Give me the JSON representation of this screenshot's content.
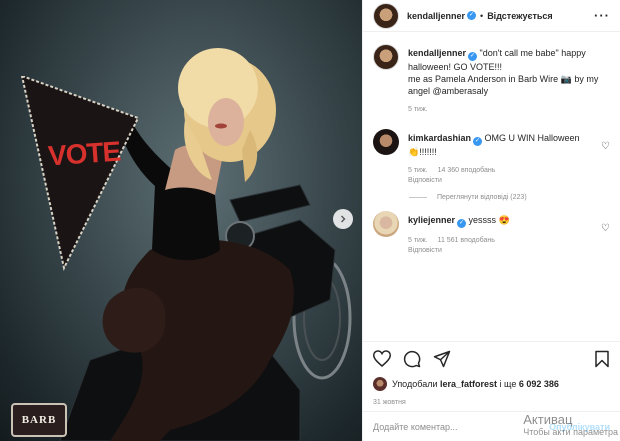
{
  "header": {
    "username": "kendalljenner",
    "follow_label": "Відстежується"
  },
  "caption": {
    "username": "kendalljenner",
    "line1": "\"don't call me babe\" happy halloween! GO VOTE!!!",
    "line2_prefix": "me as Pamela Anderson in Barb Wire",
    "line2_camera_icon": "📷",
    "line2_suffix": "by my angel @amberasaly",
    "time": "5 тиж."
  },
  "comments": [
    {
      "username": "kimkardashian",
      "text": "OMG U WIN Halloween 👏!!!!!!!",
      "time": "5 тиж.",
      "likes": "14 360 вподобань",
      "reply": "Відповісти"
    },
    {
      "username": "kyliejenner",
      "text": "yessss 😍",
      "time": "5 тиж.",
      "likes": "11 561 вподобань",
      "reply": "Відповісти"
    }
  ],
  "view_replies": "Переглянути відповіді (223)",
  "likes_line": {
    "prefix": "Уподобали",
    "user": "lera_fatforest",
    "conj": "і ще",
    "count": "6 092 386"
  },
  "date": "31 жовтня",
  "comment_input": {
    "placeholder": "Додайте коментар...",
    "publish": "Опублікувати"
  },
  "photo": {
    "flag_text": "VOTE",
    "sign_text": "BARB"
  },
  "watermark": {
    "line1": "Активац",
    "line2": "Чтобы акти параметра"
  },
  "icons": {
    "heart": "heart-icon",
    "comment": "comment-icon",
    "share": "share-icon",
    "bookmark": "bookmark-icon",
    "more": "more-icon",
    "next": "chevron-right-icon"
  },
  "colors": {
    "verified": "#3897f0",
    "publish_disabled": "#b2dffc",
    "meta_gray": "#8e8e8e"
  }
}
